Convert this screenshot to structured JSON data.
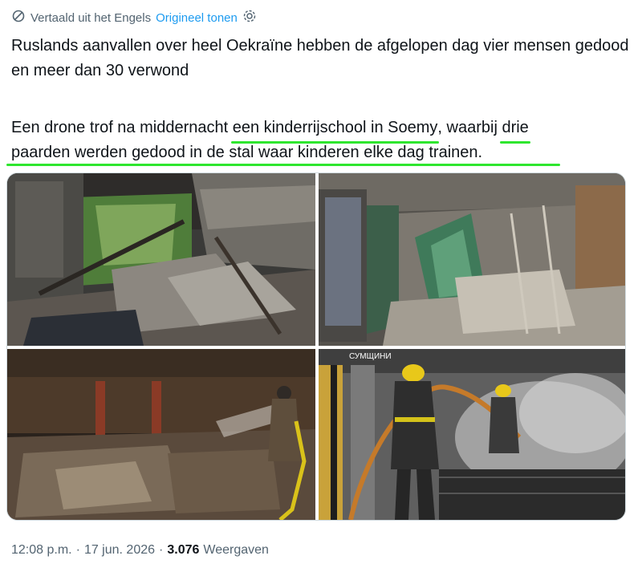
{
  "translation_bar": {
    "label": "Vertaald uit het Engels",
    "show_original": "Origineel tonen"
  },
  "post": {
    "paragraph1": "Ruslands aanvallen over heel Oekraïne hebben de afgelopen dag vier mensen gedood en meer dan 30 verwond",
    "p2_part1": "Een drone trof na middernacht ",
    "p2_highlight1": "een kinderrijschool in Soemy",
    "p2_part2": ", waarbij ",
    "p2_highlight2": "drie",
    "p2_line2": "paarden werden gedood in de stal waar kinderen elke dag trainen."
  },
  "media": {
    "photo4_watermark": "СУМЩИНИ"
  },
  "footer": {
    "time": "12:08 p.m.",
    "date": "17 jun. 2026",
    "views_count": "3.076",
    "views_label": "Weergaven"
  },
  "colors": {
    "highlight": "#2ee62e",
    "link": "#1d9bf0",
    "helmet": "#e8c81a"
  }
}
